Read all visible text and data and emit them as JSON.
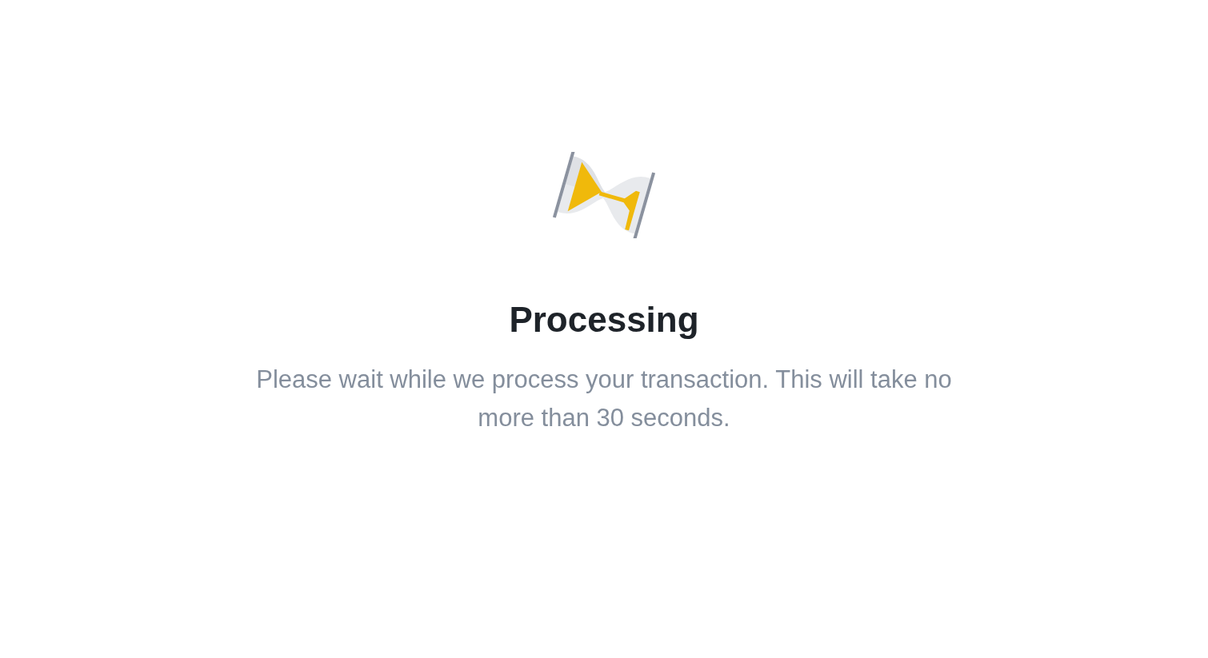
{
  "status": {
    "title": "Processing",
    "message": "Please wait while we process your transaction. This will take no more than 30 seconds."
  }
}
